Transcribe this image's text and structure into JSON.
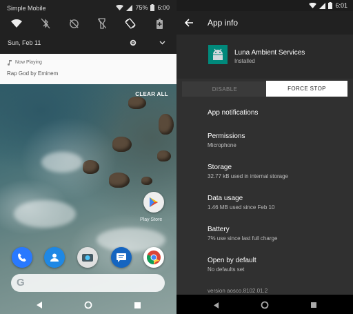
{
  "left": {
    "status_bar": {
      "carrier": "Simple Mobile",
      "battery": "75%",
      "time": "6:00"
    },
    "quick_settings": [
      "wifi-icon",
      "bluetooth-off-icon",
      "dnd-off-icon",
      "flashlight-off-icon",
      "auto-rotate-icon",
      "battery-saver-icon"
    ],
    "date": "Sun, Feb 11",
    "notification": {
      "app": "Now Playing",
      "title": "Rap God by Eminem"
    },
    "clear_all": "CLEAR ALL",
    "play_store_label": "Play Store",
    "dock": [
      "phone-icon",
      "contacts-icon",
      "camera-icon",
      "messages-icon",
      "chrome-icon"
    ],
    "search_logo": "G"
  },
  "right": {
    "status_bar": {
      "time": "6:01"
    },
    "title": "App info",
    "app": {
      "name": "Luna Ambient Services",
      "status": "Installed"
    },
    "buttons": {
      "disable": "DISABLE",
      "force_stop": "FORCE STOP"
    },
    "rows": [
      {
        "title": "App notifications",
        "sub": ""
      },
      {
        "title": "Permissions",
        "sub": "Microphone"
      },
      {
        "title": "Storage",
        "sub": "32.77 kB used in internal storage"
      },
      {
        "title": "Data usage",
        "sub": "1.46 MB used since Feb 10"
      },
      {
        "title": "Battery",
        "sub": "7% use since last full charge"
      },
      {
        "title": "Open by default",
        "sub": "No defaults set"
      }
    ],
    "version": "version aosco.8102.01.2"
  },
  "colors": {
    "accent_teal": "#00897b",
    "dark_bg": "#303030"
  }
}
